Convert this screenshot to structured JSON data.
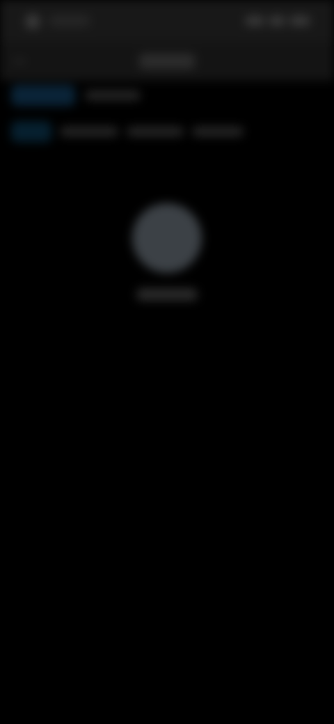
{
  "theme": {
    "background": "#000000",
    "status_bar": "#181818",
    "header": "#141414",
    "accent_chip": "#0a2438",
    "avatar": "#3c4146"
  },
  "status_bar": {
    "left_icon": "app-icon",
    "right_icons": [
      "signal-icon",
      "wifi-icon",
      "battery-icon"
    ]
  },
  "header": {
    "back_icon": "back-arrow-icon"
  },
  "filter_rows": [
    {
      "chip_icon": "tag-icon"
    },
    {
      "chip_icon": "tag-icon"
    }
  ],
  "profile": {
    "avatar_icon": "avatar-icon"
  }
}
